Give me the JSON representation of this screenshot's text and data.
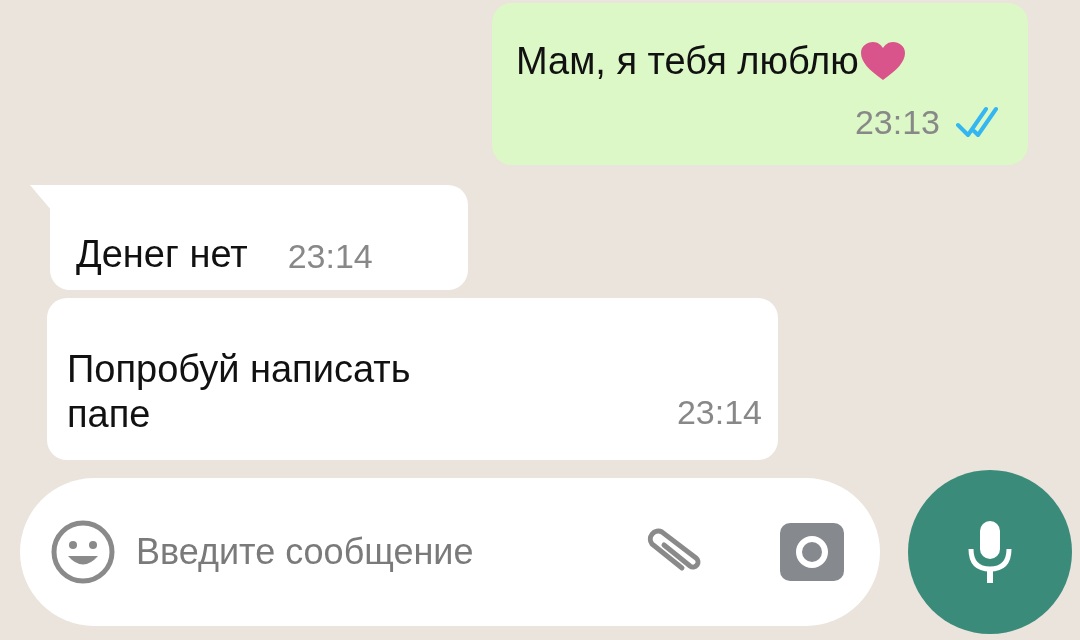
{
  "messages": [
    {
      "kind": "outgoing",
      "text": "Мам, я тебя люблю",
      "time": "23:13",
      "read": true
    },
    {
      "kind": "incoming",
      "text": "Денег нет",
      "time": "23:14",
      "tail": true
    },
    {
      "kind": "incoming",
      "text": "Попробуй написать папе",
      "time": "23:14",
      "tail": false
    }
  ],
  "composer": {
    "placeholder": "Введите сообщение"
  }
}
